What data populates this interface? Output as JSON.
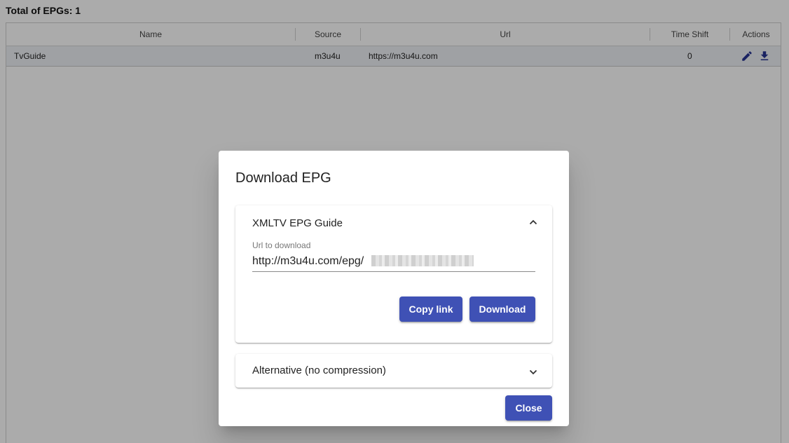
{
  "summary": {
    "total_label": "Total of EPGs: 1"
  },
  "table": {
    "columns": [
      "Name",
      "Source",
      "Url",
      "Time Shift",
      "Actions"
    ],
    "rows": [
      {
        "name": "TvGuide",
        "source": "m3u4u",
        "url": "https://m3u4u.com",
        "time_shift": "0"
      }
    ],
    "row_actions": [
      "edit-icon",
      "download-icon"
    ]
  },
  "dialog": {
    "title": "Download EPG",
    "panels": [
      {
        "title": "XMLTV EPG Guide",
        "expanded": true,
        "field_label": "Url to download",
        "field_value": "http://m3u4u.com/epg/",
        "buttons": {
          "copy": "Copy link",
          "download": "Download"
        }
      },
      {
        "title": "Alternative (no compression)",
        "expanded": false
      }
    ],
    "close_label": "Close"
  },
  "colors": {
    "primary": "#3f51b5",
    "backdrop": "rgba(0,0,0,0.33)"
  }
}
